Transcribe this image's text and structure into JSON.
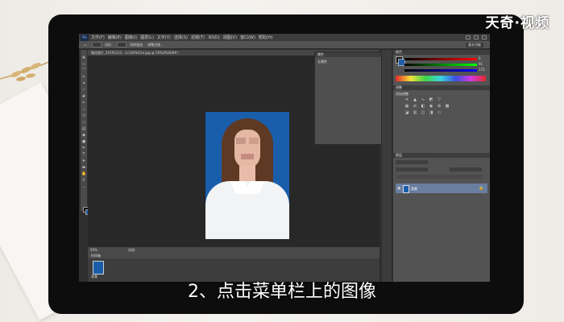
{
  "watermark": {
    "brand": "天奇·视频"
  },
  "subtitle": "2、点击菜单栏上的图像",
  "photoshop": {
    "logo": "Ps",
    "menu": [
      "文件(F)",
      "编辑(E)",
      "图像(I)",
      "图层(L)",
      "文字(Y)",
      "选择(S)",
      "滤镜(T)",
      "3D(D)",
      "视图(V)",
      "窗口(W)",
      "帮助(H)"
    ],
    "options": {
      "feather_label": "羽化:",
      "feather_value": "0 像素",
      "antialias_label": "消除锯齿",
      "refine_label": "调整边缘...",
      "workspace": "基本功能"
    },
    "document_tab": "微信图片_20191212...1c1bf5b21e.jpg @ 50%(RGB/8#)",
    "status": {
      "zoom": "50%",
      "doc": "文档:"
    },
    "timeline": {
      "title": "时间轴",
      "thumb_label": "背景"
    },
    "float_panel": {
      "title": "属性",
      "text": "无属性"
    },
    "panels": {
      "color_title": "颜色",
      "rgb_values": [
        "0",
        "91",
        "172"
      ],
      "adjust_title": "调整",
      "adjust_subtitle": "添加调整",
      "layers_title": "图层",
      "layer_name": "背景"
    },
    "colors": {
      "foreground": "#111111",
      "background": "#1f5da8",
      "photo_bg": "#1a5eab"
    }
  }
}
